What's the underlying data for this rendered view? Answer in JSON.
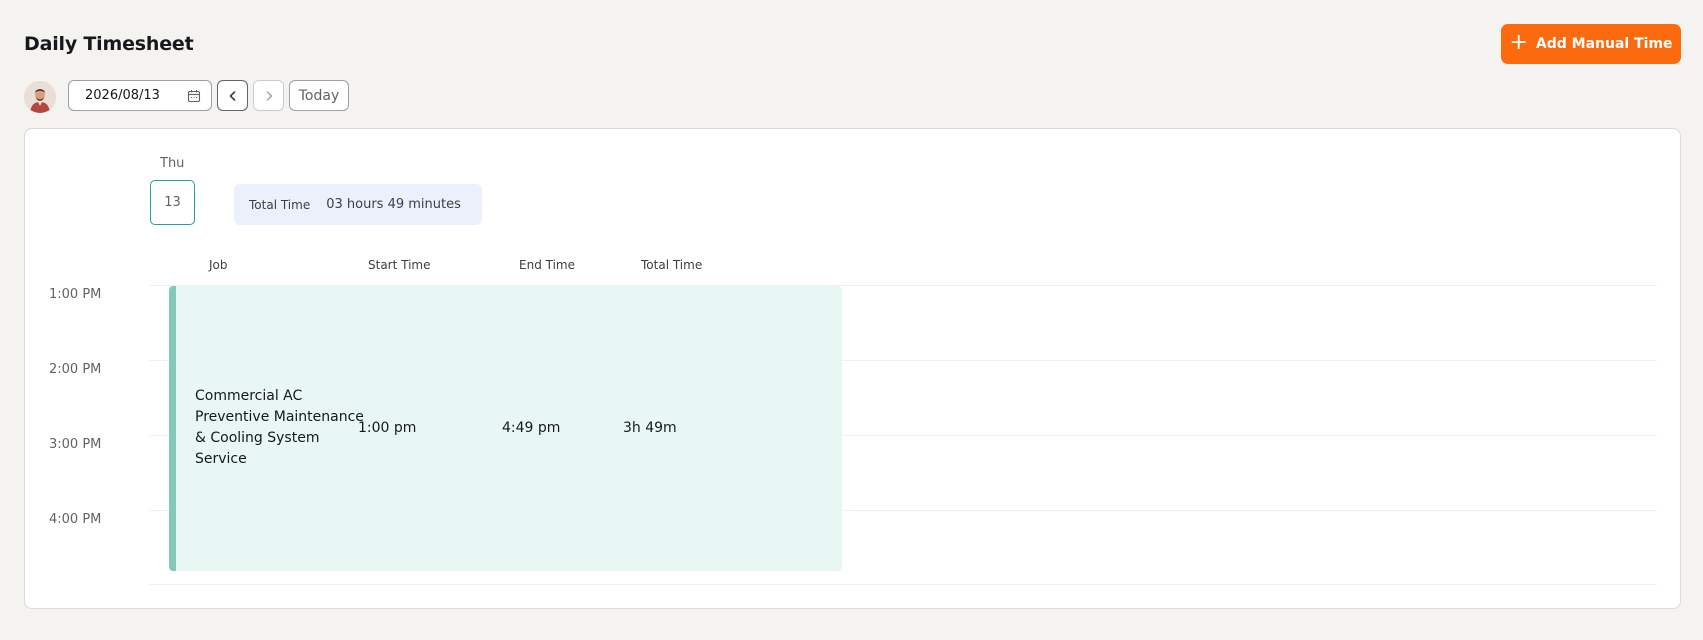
{
  "header": {
    "title": "Daily Timesheet",
    "add_button_label": "Add Manual Time",
    "add_button_icon": "plus-icon",
    "accent_color": "#fb6a0c"
  },
  "toolbar": {
    "date_value": "2026/08/13",
    "date_icon": "calendar-icon",
    "prev_icon": "chevron-left-icon",
    "next_icon": "chevron-right-icon",
    "today_label": "Today"
  },
  "day": {
    "weekday": "Thu",
    "date_number": "13",
    "total_label": "Total Time",
    "total_value": "03 hours 49 minutes"
  },
  "table": {
    "columns": [
      "Job",
      "Start Time",
      "End Time",
      "Total Time"
    ],
    "hours": [
      "1:00 PM",
      "2:00 PM",
      "3:00 PM",
      "4:00 PM"
    ],
    "entries": [
      {
        "job": "Commercial AC Preventive Maintenance & Cooling System Service",
        "start": "1:00 pm",
        "end": "4:49 pm",
        "total": "3h 49m",
        "color": "#84c9b7"
      }
    ]
  }
}
